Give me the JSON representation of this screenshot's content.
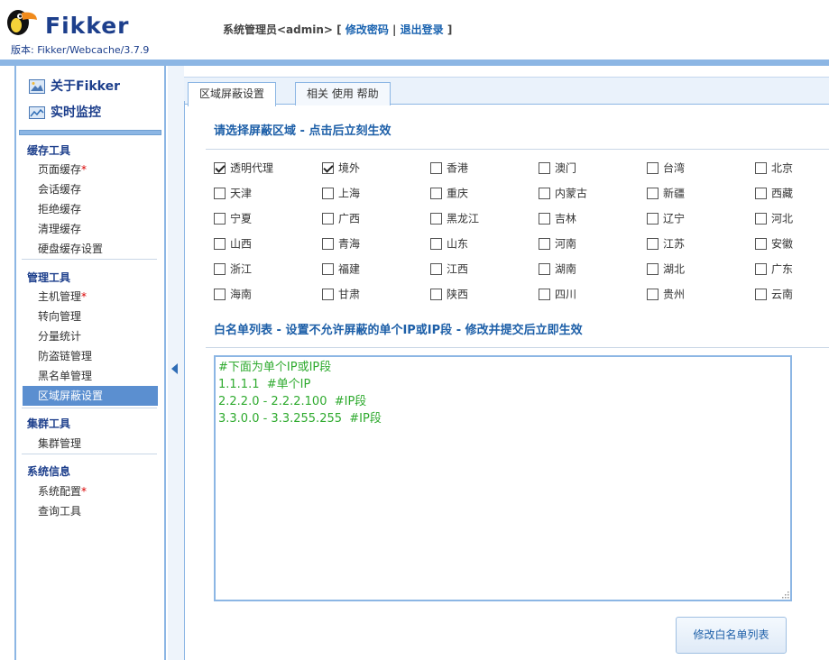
{
  "header": {
    "brand": "Fikker",
    "version": "版本: Fikker/Webcache/3.7.9",
    "user_label": "系统管理员<admin>",
    "bracket_open": "[",
    "change_password": "修改密码",
    "divider": "|",
    "logout": "退出登录",
    "bracket_close": "]"
  },
  "sidebar": {
    "about": "关于Fikker",
    "monitor": "实时监控",
    "groups": [
      {
        "title": "缓存工具",
        "items": [
          {
            "label": "页面缓存",
            "star": "*"
          },
          {
            "label": "会话缓存",
            "star": ""
          },
          {
            "label": "拒绝缓存",
            "star": ""
          },
          {
            "label": "清理缓存",
            "star": ""
          },
          {
            "label": "硬盘缓存设置",
            "star": ""
          }
        ]
      },
      {
        "title": "管理工具",
        "items": [
          {
            "label": "主机管理",
            "star": "*"
          },
          {
            "label": "转向管理",
            "star": ""
          },
          {
            "label": "分量统计",
            "star": ""
          },
          {
            "label": "防盗链管理",
            "star": ""
          },
          {
            "label": "黑名单管理",
            "star": ""
          },
          {
            "label": "区域屏蔽设置",
            "star": ""
          }
        ]
      },
      {
        "title": "集群工具",
        "items": [
          {
            "label": "集群管理",
            "star": ""
          }
        ]
      },
      {
        "title": "系统信息",
        "items": [
          {
            "label": "系统配置",
            "star": "*"
          },
          {
            "label": "查询工具",
            "star": ""
          }
        ]
      }
    ],
    "active_item": "区域屏蔽设置"
  },
  "tabs": [
    {
      "label": "区域屏蔽设置",
      "active": true
    },
    {
      "label": "相关 使用 帮助",
      "active": false
    }
  ],
  "region_section": {
    "title": "请选择屏蔽区域 - 点击后立刻生效",
    "regions": [
      {
        "label": "透明代理",
        "checked": true
      },
      {
        "label": "境外",
        "checked": true
      },
      {
        "label": "香港",
        "checked": false
      },
      {
        "label": "澳门",
        "checked": false
      },
      {
        "label": "台湾",
        "checked": false
      },
      {
        "label": "北京",
        "checked": false
      },
      {
        "label": "天津",
        "checked": false
      },
      {
        "label": "上海",
        "checked": false
      },
      {
        "label": "重庆",
        "checked": false
      },
      {
        "label": "内蒙古",
        "checked": false
      },
      {
        "label": "新疆",
        "checked": false
      },
      {
        "label": "西藏",
        "checked": false
      },
      {
        "label": "宁夏",
        "checked": false
      },
      {
        "label": "广西",
        "checked": false
      },
      {
        "label": "黑龙江",
        "checked": false
      },
      {
        "label": "吉林",
        "checked": false
      },
      {
        "label": "辽宁",
        "checked": false
      },
      {
        "label": "河北",
        "checked": false
      },
      {
        "label": "山西",
        "checked": false
      },
      {
        "label": "青海",
        "checked": false
      },
      {
        "label": "山东",
        "checked": false
      },
      {
        "label": "河南",
        "checked": false
      },
      {
        "label": "江苏",
        "checked": false
      },
      {
        "label": "安徽",
        "checked": false
      },
      {
        "label": "浙江",
        "checked": false
      },
      {
        "label": "福建",
        "checked": false
      },
      {
        "label": "江西",
        "checked": false
      },
      {
        "label": "湖南",
        "checked": false
      },
      {
        "label": "湖北",
        "checked": false
      },
      {
        "label": "广东",
        "checked": false
      },
      {
        "label": "海南",
        "checked": false
      },
      {
        "label": "甘肃",
        "checked": false
      },
      {
        "label": "陕西",
        "checked": false
      },
      {
        "label": "四川",
        "checked": false
      },
      {
        "label": "贵州",
        "checked": false
      },
      {
        "label": "云南",
        "checked": false
      }
    ]
  },
  "whitelist_section": {
    "title": "白名单列表 - 设置不允许屏蔽的单个IP或IP段 - 修改并提交后立即生效",
    "content": "#下面为单个IP或IP段\n1.1.1.1  #单个IP\n2.2.2.0 - 2.2.2.100  #IP段\n3.3.0.0 - 3.3.255.255  #IP段",
    "submit_label": "修改白名单列表"
  },
  "colors": {
    "accent": "#8cb6e4",
    "brand_blue": "#1d3f8c",
    "active_item_bg": "#5b8fd0",
    "text_green": "#2eaa2e",
    "star_red": "#d90000"
  }
}
